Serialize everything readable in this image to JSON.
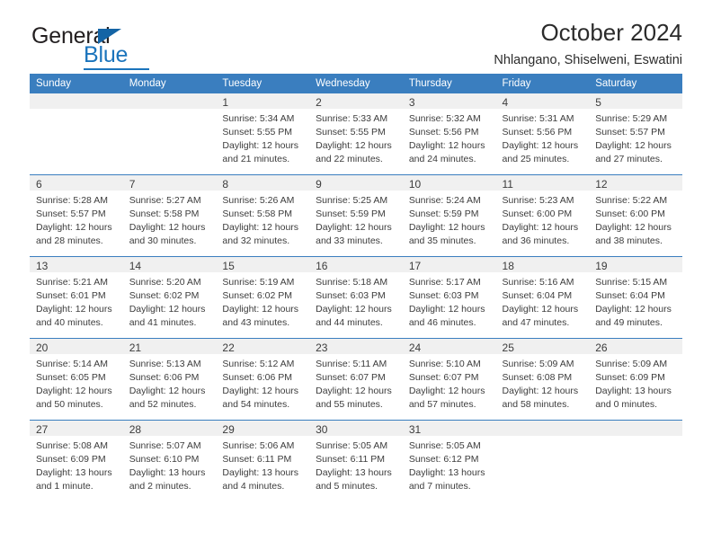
{
  "brand": {
    "name_dark": "General",
    "name_blue": "Blue",
    "accent_color": "#1b74bc",
    "header_color": "#3a7ebf"
  },
  "header": {
    "title": "October 2024",
    "subtitle": "Nhlangano, Shiselweni, Eswatini"
  },
  "calendar": {
    "weekdays": [
      "Sunday",
      "Monday",
      "Tuesday",
      "Wednesday",
      "Thursday",
      "Friday",
      "Saturday"
    ],
    "weeks": [
      [
        {
          "day": "",
          "blank": true
        },
        {
          "day": "",
          "blank": true
        },
        {
          "day": "1",
          "sunrise": "Sunrise: 5:34 AM",
          "sunset": "Sunset: 5:55 PM",
          "daylight": "Daylight: 12 hours and 21 minutes."
        },
        {
          "day": "2",
          "sunrise": "Sunrise: 5:33 AM",
          "sunset": "Sunset: 5:55 PM",
          "daylight": "Daylight: 12 hours and 22 minutes."
        },
        {
          "day": "3",
          "sunrise": "Sunrise: 5:32 AM",
          "sunset": "Sunset: 5:56 PM",
          "daylight": "Daylight: 12 hours and 24 minutes."
        },
        {
          "day": "4",
          "sunrise": "Sunrise: 5:31 AM",
          "sunset": "Sunset: 5:56 PM",
          "daylight": "Daylight: 12 hours and 25 minutes."
        },
        {
          "day": "5",
          "sunrise": "Sunrise: 5:29 AM",
          "sunset": "Sunset: 5:57 PM",
          "daylight": "Daylight: 12 hours and 27 minutes."
        }
      ],
      [
        {
          "day": "6",
          "sunrise": "Sunrise: 5:28 AM",
          "sunset": "Sunset: 5:57 PM",
          "daylight": "Daylight: 12 hours and 28 minutes."
        },
        {
          "day": "7",
          "sunrise": "Sunrise: 5:27 AM",
          "sunset": "Sunset: 5:58 PM",
          "daylight": "Daylight: 12 hours and 30 minutes."
        },
        {
          "day": "8",
          "sunrise": "Sunrise: 5:26 AM",
          "sunset": "Sunset: 5:58 PM",
          "daylight": "Daylight: 12 hours and 32 minutes."
        },
        {
          "day": "9",
          "sunrise": "Sunrise: 5:25 AM",
          "sunset": "Sunset: 5:59 PM",
          "daylight": "Daylight: 12 hours and 33 minutes."
        },
        {
          "day": "10",
          "sunrise": "Sunrise: 5:24 AM",
          "sunset": "Sunset: 5:59 PM",
          "daylight": "Daylight: 12 hours and 35 minutes."
        },
        {
          "day": "11",
          "sunrise": "Sunrise: 5:23 AM",
          "sunset": "Sunset: 6:00 PM",
          "daylight": "Daylight: 12 hours and 36 minutes."
        },
        {
          "day": "12",
          "sunrise": "Sunrise: 5:22 AM",
          "sunset": "Sunset: 6:00 PM",
          "daylight": "Daylight: 12 hours and 38 minutes."
        }
      ],
      [
        {
          "day": "13",
          "sunrise": "Sunrise: 5:21 AM",
          "sunset": "Sunset: 6:01 PM",
          "daylight": "Daylight: 12 hours and 40 minutes."
        },
        {
          "day": "14",
          "sunrise": "Sunrise: 5:20 AM",
          "sunset": "Sunset: 6:02 PM",
          "daylight": "Daylight: 12 hours and 41 minutes."
        },
        {
          "day": "15",
          "sunrise": "Sunrise: 5:19 AM",
          "sunset": "Sunset: 6:02 PM",
          "daylight": "Daylight: 12 hours and 43 minutes."
        },
        {
          "day": "16",
          "sunrise": "Sunrise: 5:18 AM",
          "sunset": "Sunset: 6:03 PM",
          "daylight": "Daylight: 12 hours and 44 minutes."
        },
        {
          "day": "17",
          "sunrise": "Sunrise: 5:17 AM",
          "sunset": "Sunset: 6:03 PM",
          "daylight": "Daylight: 12 hours and 46 minutes."
        },
        {
          "day": "18",
          "sunrise": "Sunrise: 5:16 AM",
          "sunset": "Sunset: 6:04 PM",
          "daylight": "Daylight: 12 hours and 47 minutes."
        },
        {
          "day": "19",
          "sunrise": "Sunrise: 5:15 AM",
          "sunset": "Sunset: 6:04 PM",
          "daylight": "Daylight: 12 hours and 49 minutes."
        }
      ],
      [
        {
          "day": "20",
          "sunrise": "Sunrise: 5:14 AM",
          "sunset": "Sunset: 6:05 PM",
          "daylight": "Daylight: 12 hours and 50 minutes."
        },
        {
          "day": "21",
          "sunrise": "Sunrise: 5:13 AM",
          "sunset": "Sunset: 6:06 PM",
          "daylight": "Daylight: 12 hours and 52 minutes."
        },
        {
          "day": "22",
          "sunrise": "Sunrise: 5:12 AM",
          "sunset": "Sunset: 6:06 PM",
          "daylight": "Daylight: 12 hours and 54 minutes."
        },
        {
          "day": "23",
          "sunrise": "Sunrise: 5:11 AM",
          "sunset": "Sunset: 6:07 PM",
          "daylight": "Daylight: 12 hours and 55 minutes."
        },
        {
          "day": "24",
          "sunrise": "Sunrise: 5:10 AM",
          "sunset": "Sunset: 6:07 PM",
          "daylight": "Daylight: 12 hours and 57 minutes."
        },
        {
          "day": "25",
          "sunrise": "Sunrise: 5:09 AM",
          "sunset": "Sunset: 6:08 PM",
          "daylight": "Daylight: 12 hours and 58 minutes."
        },
        {
          "day": "26",
          "sunrise": "Sunrise: 5:09 AM",
          "sunset": "Sunset: 6:09 PM",
          "daylight": "Daylight: 13 hours and 0 minutes."
        }
      ],
      [
        {
          "day": "27",
          "sunrise": "Sunrise: 5:08 AM",
          "sunset": "Sunset: 6:09 PM",
          "daylight": "Daylight: 13 hours and 1 minute."
        },
        {
          "day": "28",
          "sunrise": "Sunrise: 5:07 AM",
          "sunset": "Sunset: 6:10 PM",
          "daylight": "Daylight: 13 hours and 2 minutes."
        },
        {
          "day": "29",
          "sunrise": "Sunrise: 5:06 AM",
          "sunset": "Sunset: 6:11 PM",
          "daylight": "Daylight: 13 hours and 4 minutes."
        },
        {
          "day": "30",
          "sunrise": "Sunrise: 5:05 AM",
          "sunset": "Sunset: 6:11 PM",
          "daylight": "Daylight: 13 hours and 5 minutes."
        },
        {
          "day": "31",
          "sunrise": "Sunrise: 5:05 AM",
          "sunset": "Sunset: 6:12 PM",
          "daylight": "Daylight: 13 hours and 7 minutes."
        },
        {
          "day": "",
          "blank": true
        },
        {
          "day": "",
          "blank": true
        }
      ]
    ]
  }
}
